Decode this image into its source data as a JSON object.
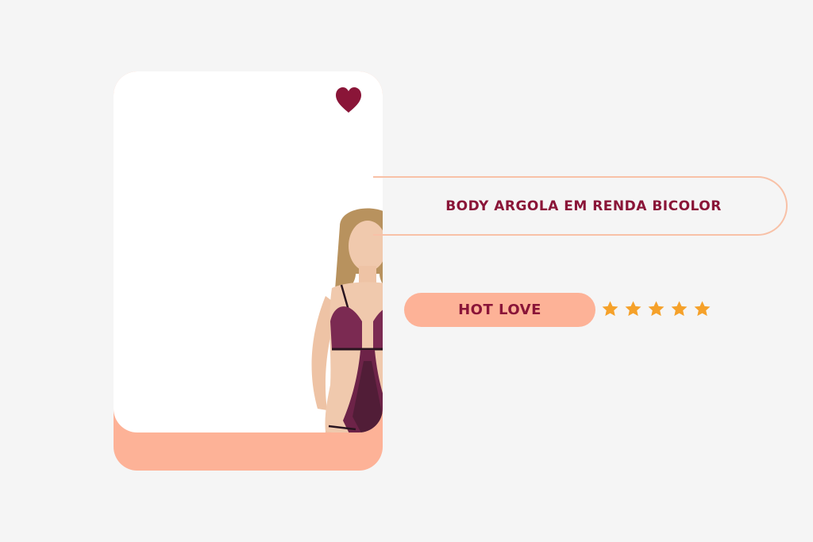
{
  "product": {
    "name": "BODY ARGOLA EM RENDA BICOLOR",
    "brand": "HOT LOVE",
    "rating": 5,
    "max_rating": 5,
    "favorited": true
  },
  "colors": {
    "background": "#f5f5f5",
    "accent_peach": "#fdb297",
    "brand_burgundy": "#8a1538",
    "star": "#f5a12a",
    "title_border": "#f8c1a7"
  },
  "icons": {
    "favorite": "heart-icon",
    "rating": "star-icon"
  }
}
